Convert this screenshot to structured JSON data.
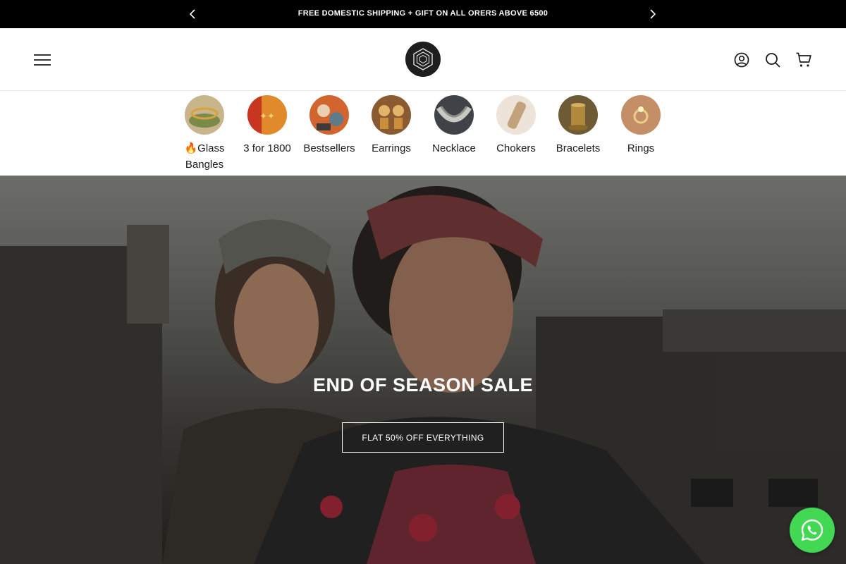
{
  "announcement": {
    "text": "FREE DOMESTIC SHIPPING + GIFT ON ALL ORERS ABOVE 6500",
    "prev_icon": "chevron-left-icon",
    "next_icon": "chevron-right-icon"
  },
  "header": {
    "menu_icon": "hamburger-menu-icon",
    "logo_icon": "hexagon-logo",
    "account_icon": "account-icon",
    "search_icon": "search-icon",
    "cart_icon": "cart-icon"
  },
  "categories": [
    {
      "label": "🔥Glass Bangles",
      "thumb_color": "#b79a63"
    },
    {
      "label": "3 for 1800",
      "thumb_color": "#d9742a"
    },
    {
      "label": "Bestsellers",
      "thumb_color": "#c7562c"
    },
    {
      "label": "Earrings",
      "thumb_color": "#a8743b"
    },
    {
      "label": "Necklace",
      "thumb_color": "#5d5f63"
    },
    {
      "label": "Chokers",
      "thumb_color": "#d8c6b3"
    },
    {
      "label": "Bracelets",
      "thumb_color": "#8d6a2f"
    },
    {
      "label": "Rings",
      "thumb_color": "#c99870"
    }
  ],
  "hero": {
    "title": "END OF SEASON SALE",
    "button_label": "FLAT 50% OFF EVERYTHING"
  },
  "whatsapp": {
    "icon": "whatsapp-icon",
    "color": "#43d854"
  },
  "colors": {
    "announcement_bg": "#000000",
    "logo_bg": "#1e1e1e"
  }
}
